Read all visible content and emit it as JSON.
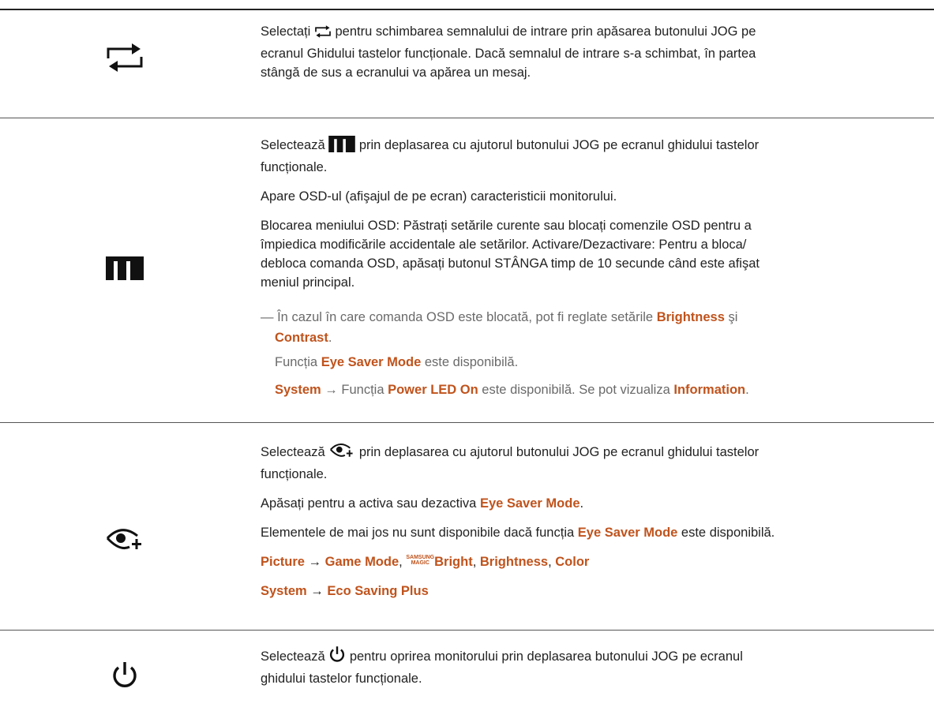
{
  "rows": {
    "input": {
      "text_before": "Selectați",
      "text_after": "pentru schimbarea semnalului de intrare prin apăsarea butonului JOG pe",
      "line2": "ecranul Ghidului tastelor funcționale. Dacă semnalul de intrare s-a schimbat, în partea",
      "line3": "stângă de sus a ecranului va apărea un mesaj."
    },
    "menu": {
      "p1_before": "Selectează",
      "p1_after": "prin deplasarea cu ajutorul butonului JOG pe ecranul ghidului tastelor",
      "p1_line2": "funcționale.",
      "p2": "Apare OSD-ul (afişajul de pe ecran) caracteristicii monitorului.",
      "p3_l1": "Blocarea meniului OSD: Păstrați setările curente sau blocați comenzile OSD pentru a",
      "p3_l2": "împiedica modificările accidentale ale setărilor. Activare/Dezactivare: Pentru a bloca/",
      "p3_l3": "debloca comanda OSD, apăsați butonul STÂNGA timp de 10 secunde când este afişat",
      "p3_l4": "meniul principal.",
      "note_dash": "—",
      "note1_a": "În cazul în care comanda OSD este blocată, pot fi reglate setările",
      "note1_b1": "Brightness",
      "note1_c": "şi",
      "note1_b2": "Contrast",
      "note1_end": ".",
      "note2_a": "Funcția",
      "note2_b": "Eye Saver Mode",
      "note2_c": "este disponibilă.",
      "note3_b1": "System",
      "note3_a": "→ Funcția",
      "note3_b2": "Power LED On",
      "note3_c": "este disponibilă. Se pot vizualiza",
      "note3_b3": "Information",
      "note3_end": "."
    },
    "eye": {
      "p1_before": "Selectează",
      "p1_after": "prin deplasarea cu ajutorul butonului JOG pe ecranul ghidului tastelor",
      "p1_line2": "funcționale.",
      "p2_a": "Apăsați pentru a activa sau dezactiva",
      "p2_b": "Eye Saver Mode",
      "p2_end": ".",
      "p3_a": "Elementele de mai jos nu sunt disponibile dacă funcția",
      "p3_b": "Eye Saver Mode",
      "p3_c": "este disponibilă.",
      "p4_b1": "Picture",
      "p4_arrow": "→",
      "p4_b2": "Game Mode",
      "p4_comma1": ",",
      "p4_samsung": "SAMSUNG",
      "p4_magic": "MAGIC",
      "p4_b3": "Bright",
      "p4_comma2": ",",
      "p4_b4": "Brightness",
      "p4_comma3": ",",
      "p4_b5": "Color",
      "p5_b1": "System",
      "p5_arrow": "→",
      "p5_b2": "Eco Saving Plus"
    },
    "power": {
      "p1_before": "Selectează",
      "p1_after": "pentru oprirea monitorului prin deplasarea butonului JOG pe ecranul",
      "p1_line2": "ghidului tastelor funcționale."
    }
  },
  "icons": [
    "input-switch-icon",
    "menu-grid-icon",
    "eye-saver-icon",
    "power-icon"
  ],
  "colors": {
    "accent": "#c0531c",
    "note_grey": "#6a6a6a",
    "rule": "#555555"
  }
}
